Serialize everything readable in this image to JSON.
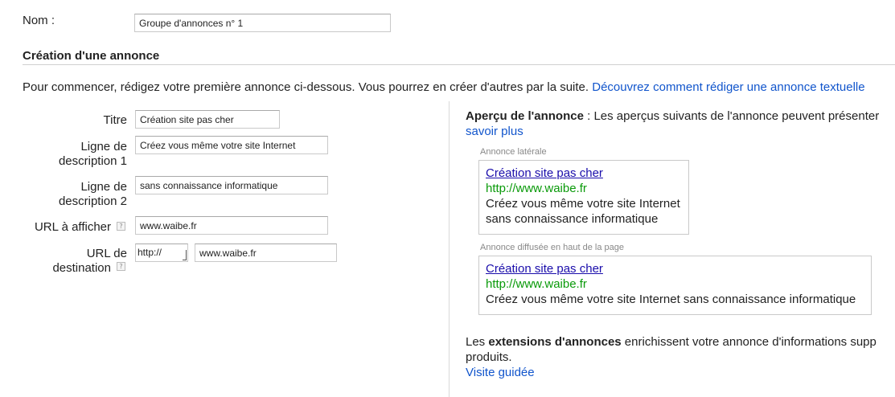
{
  "name_field": {
    "label": "Nom :",
    "value": "Groupe d'annonces n° 1"
  },
  "section_title": "Création d'une annonce",
  "intro": {
    "text": "Pour commencer, rédigez votre première annonce ci-dessous. Vous pourrez en créer d'autres par la suite.",
    "link": "Découvrez comment rédiger une annonce textuelle"
  },
  "form": {
    "titre": {
      "label": "Titre",
      "value": "Création site pas cher"
    },
    "desc1": {
      "label_line1": "Ligne de",
      "label_line2": "description 1",
      "value": "Créez vous même votre site Internet"
    },
    "desc2": {
      "label_line1": "Ligne de",
      "label_line2": "description 2",
      "value": "sans connaissance informatique"
    },
    "display_url": {
      "label": "URL à afficher",
      "value": "www.waibe.fr",
      "help": "?"
    },
    "dest_url": {
      "label_line1": "URL de",
      "label_line2": "destination",
      "protocol": "http://",
      "value": "www.waibe.fr",
      "help": "?"
    }
  },
  "preview": {
    "heading_bold": "Aperçu de l'annonce",
    "heading_rest": " : Les aperçus suivants de l'annonce peuvent présenter",
    "learn_more": "savoir plus",
    "side": {
      "caption": "Annonce latérale",
      "title": "Création site pas cher",
      "url": "http://www.waibe.fr",
      "line1": "Créez vous même votre site Internet",
      "line2": "sans connaissance informatique"
    },
    "top": {
      "caption": "Annonce diffusée en haut de la page",
      "title": "Création site pas cher",
      "url": "http://www.waibe.fr",
      "desc": "Créez vous même votre site Internet sans connaissance informatique"
    }
  },
  "extensions": {
    "prefix": "Les ",
    "bold": "extensions d'annonces",
    "rest": " enrichissent votre annonce d'informations supp",
    "line2": "produits.",
    "tour_link": "Visite guidée"
  }
}
